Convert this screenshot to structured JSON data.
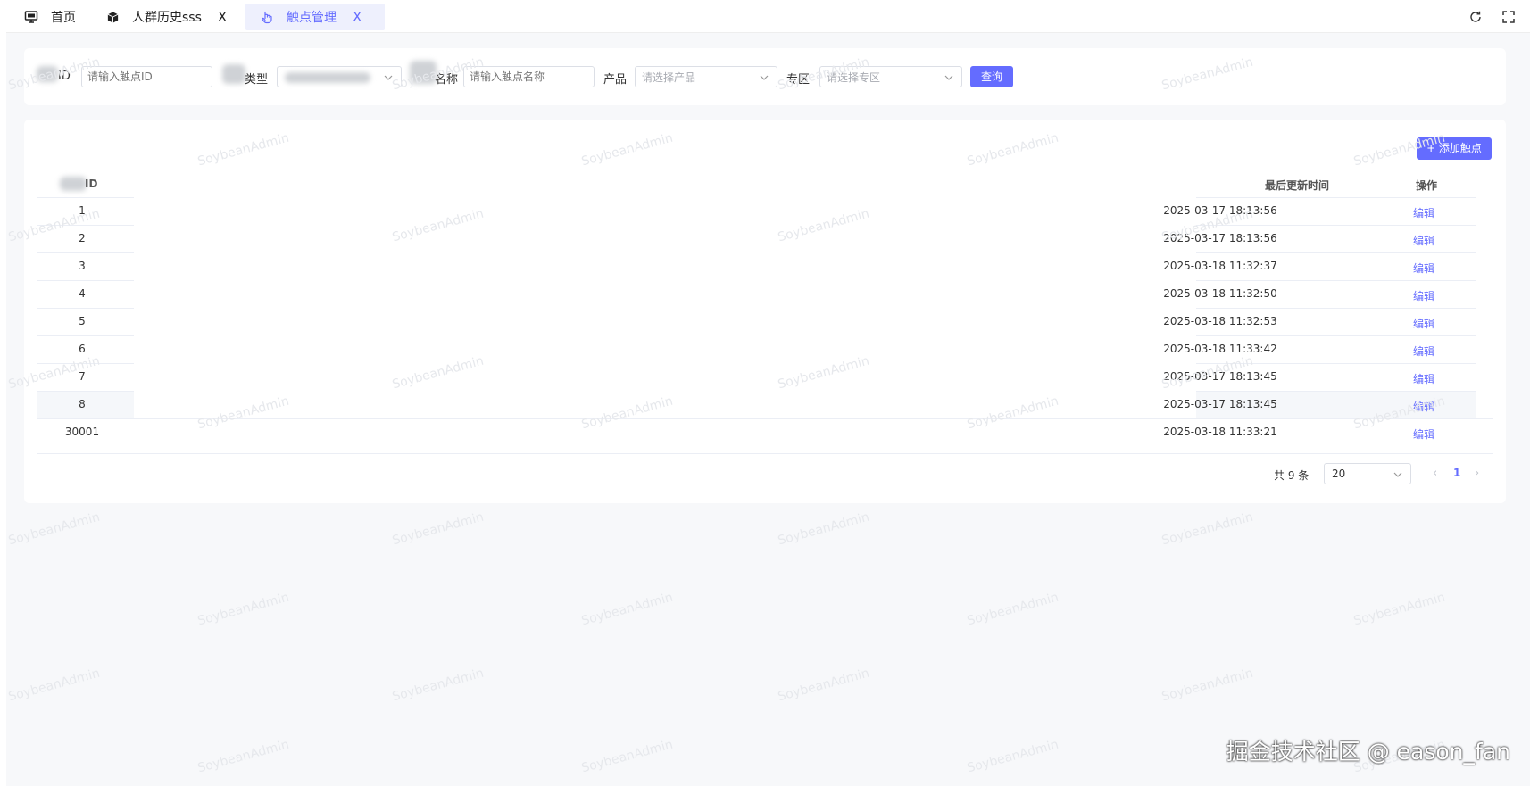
{
  "tabs": {
    "home": "首页",
    "crowd_history": "人群历史sss",
    "touchpoint_mgmt": "触点管理",
    "close_glyph": "X"
  },
  "filters": {
    "id_label": "ID",
    "id_placeholder": "请输入触点ID",
    "type_label": "类型",
    "name_label": "名称",
    "name_placeholder": "请输入触点名称",
    "product_label": "产品",
    "product_placeholder": "请选择产品",
    "zone_label": "专区",
    "zone_placeholder": "请选择专区",
    "query_button": "查询"
  },
  "table": {
    "add_button": "+ 添加触点",
    "headers": {
      "id": "ID",
      "updated": "最后更新时间",
      "action": "操作"
    },
    "rows": [
      {
        "id": "1",
        "updated": "2025-03-17 18:13:56",
        "action": "编辑"
      },
      {
        "id": "2",
        "updated": "2025-03-17 18:13:56",
        "action": "编辑"
      },
      {
        "id": "3",
        "updated": "2025-03-18 11:32:37",
        "action": "编辑"
      },
      {
        "id": "4",
        "updated": "2025-03-18 11:32:50",
        "action": "编辑"
      },
      {
        "id": "5",
        "updated": "2025-03-18 11:32:53",
        "action": "编辑"
      },
      {
        "id": "6",
        "updated": "2025-03-18 11:33:42",
        "action": "编辑"
      },
      {
        "id": "7",
        "updated": "2025-03-17 18:13:45",
        "action": "编辑"
      },
      {
        "id": "8",
        "updated": "2025-03-17 18:13:45",
        "action": "编辑"
      },
      {
        "id": "30001",
        "updated": "2025-03-18 11:33:21",
        "action": "编辑"
      }
    ],
    "highlighted_row": 8
  },
  "pagination": {
    "total": "共 9 条",
    "page_size": "20",
    "current_page": "1"
  },
  "watermark": "SoybeanAdmin",
  "corner_watermark": "掘金技术社区 @ eason_fan",
  "colors": {
    "accent": "#646cff",
    "background": "#f7f8fa"
  }
}
